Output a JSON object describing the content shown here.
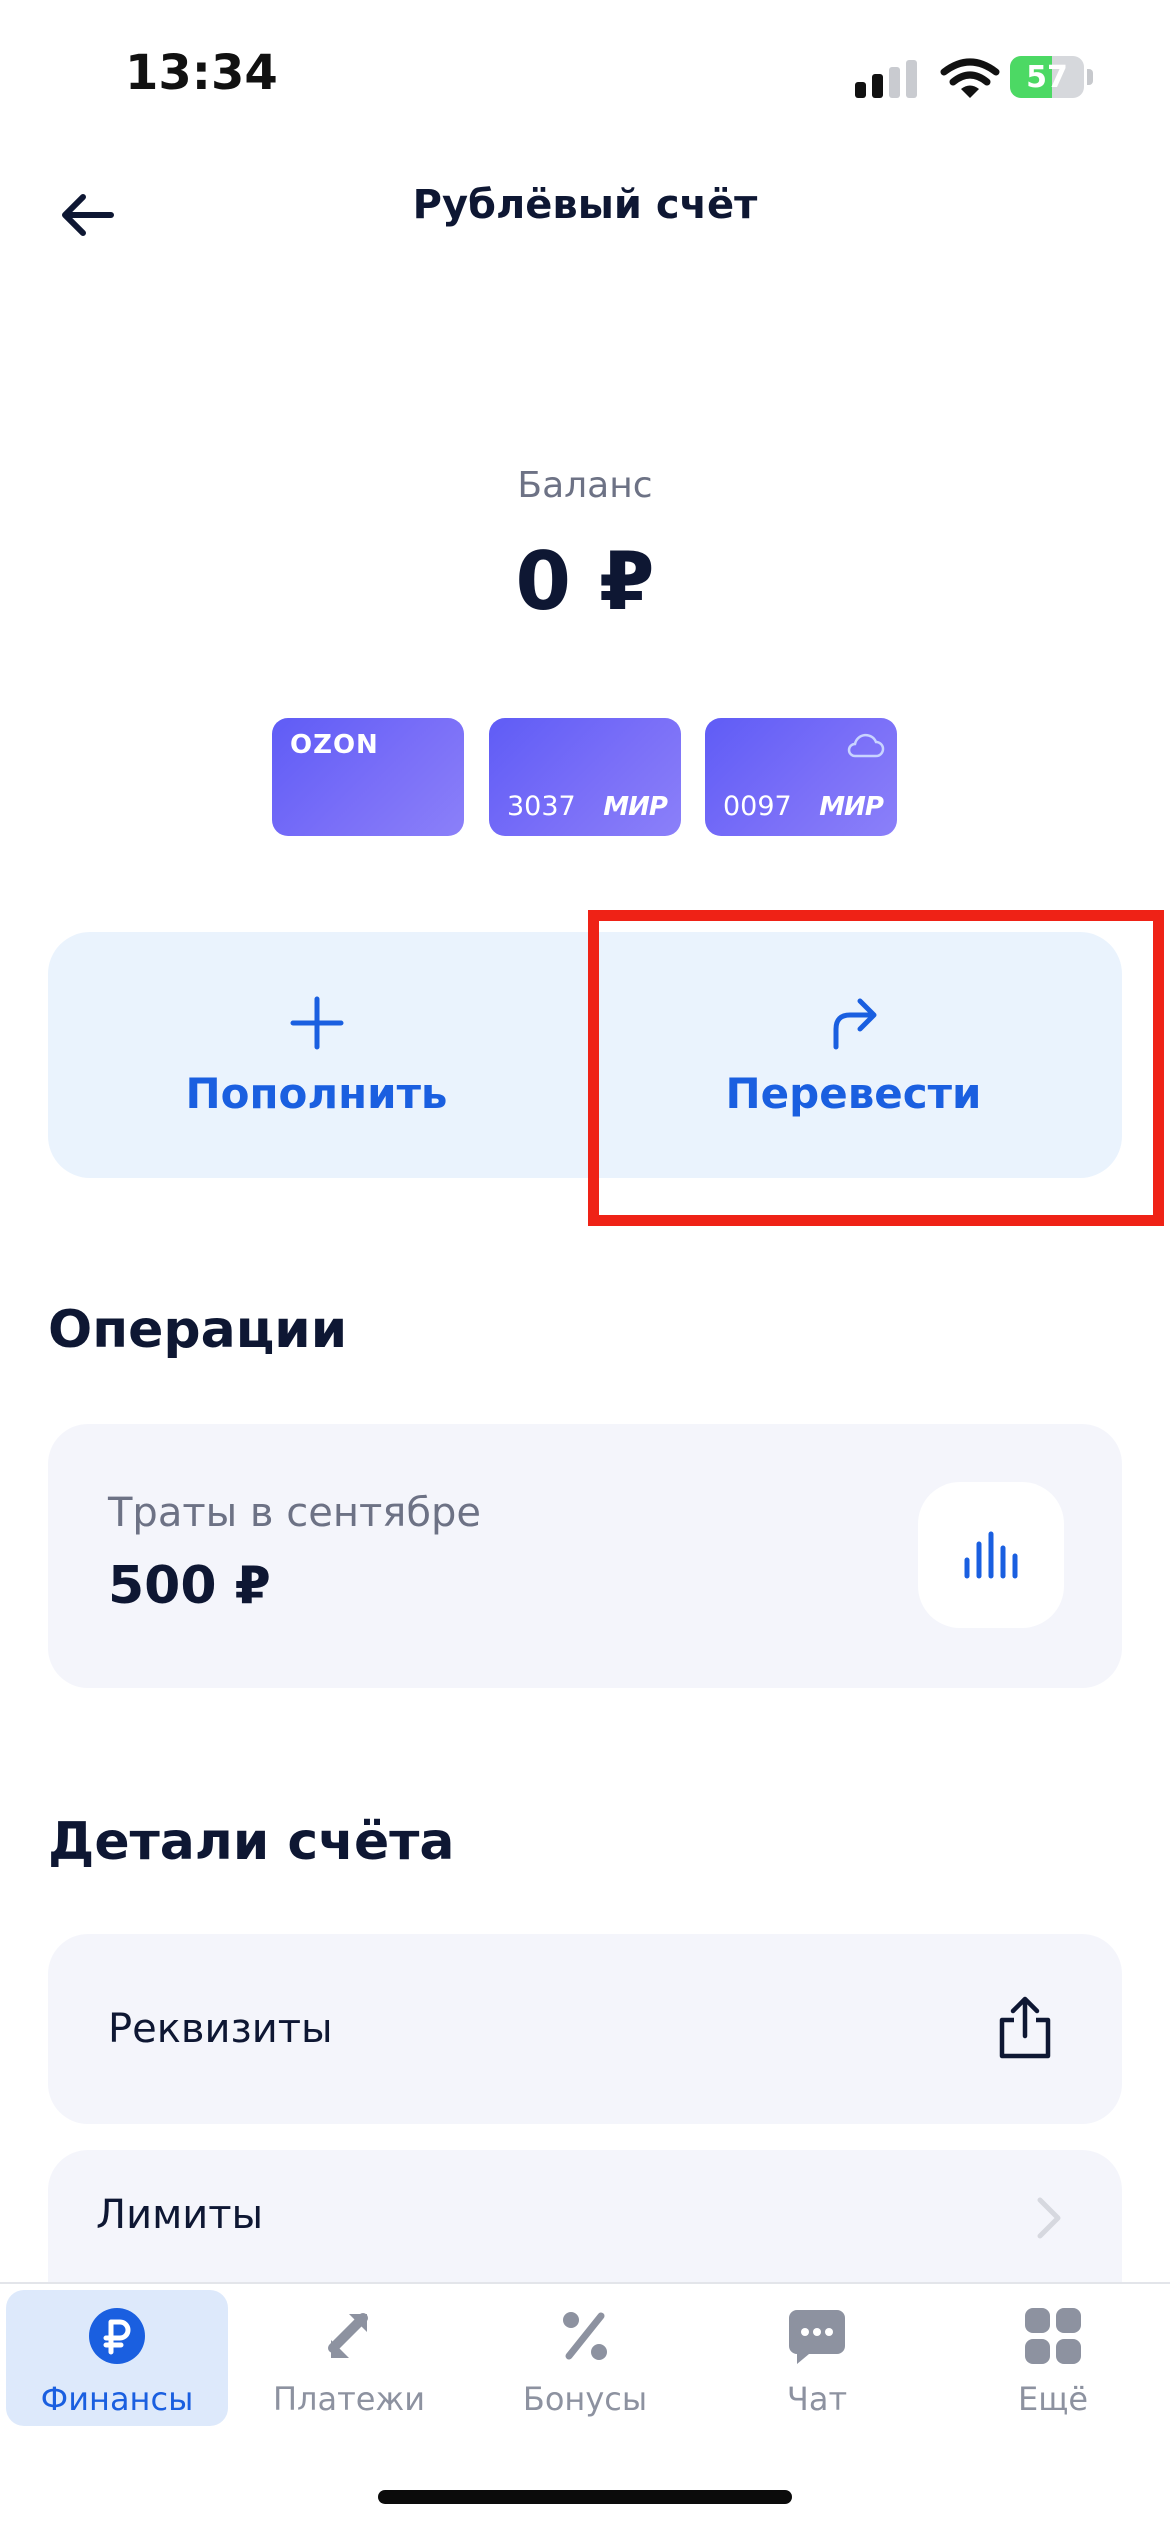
{
  "status_bar": {
    "time": "13:34",
    "battery": "57",
    "battery_level": 0.57
  },
  "header": {
    "title": "Рублёвый счёт"
  },
  "balance": {
    "label": "Баланс",
    "value": "0 ₽"
  },
  "cards": [
    {
      "logo": "OZON",
      "number": "",
      "brand": ""
    },
    {
      "logo": "",
      "number": "3037",
      "brand": "МИР"
    },
    {
      "logo": "",
      "number": "0097",
      "brand": "МИР"
    }
  ],
  "actions": {
    "topup_label": "Пополнить",
    "transfer_label": "Перевести"
  },
  "operations": {
    "title": "Операции",
    "spend_label": "Траты в сентябре",
    "spend_value": "500 ₽"
  },
  "details": {
    "title": "Детали счёта",
    "requisites_label": "Реквизиты",
    "limits_label": "Лимиты"
  },
  "tabbar": {
    "items": [
      {
        "label": "Финансы",
        "icon": "ruble-icon",
        "active": true
      },
      {
        "label": "Платежи",
        "icon": "transfer-arrows-icon",
        "active": false
      },
      {
        "label": "Бонусы",
        "icon": "percent-icon",
        "active": false
      },
      {
        "label": "Чат",
        "icon": "chat-icon",
        "active": false
      },
      {
        "label": "Ещё",
        "icon": "grid-icon",
        "active": false
      }
    ]
  },
  "colors": {
    "accent": "#1a5fe0",
    "highlight": "#ef2216",
    "card": "#6a66f7"
  }
}
